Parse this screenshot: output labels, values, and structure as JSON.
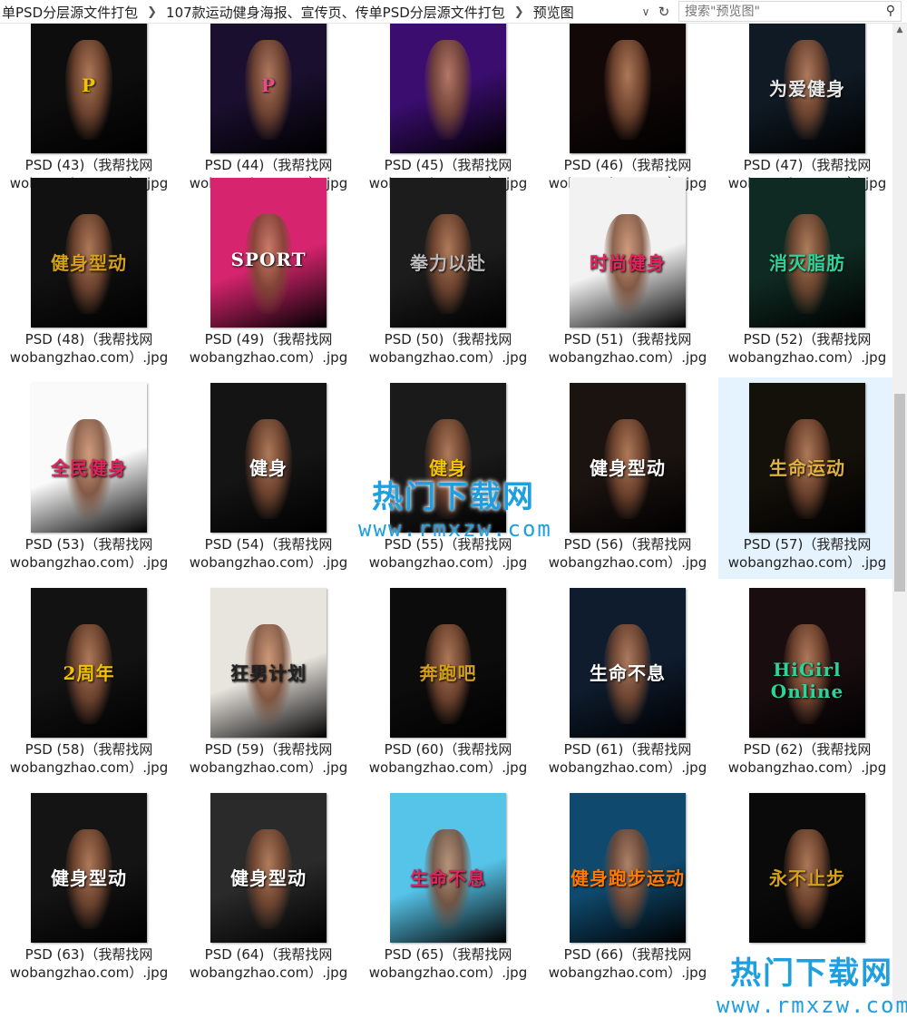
{
  "address_bar": {
    "crumbs": [
      "单PSD分层源文件打包",
      "107款运动健身海报、宣传页、传单PSD分层源文件打包",
      "预览图"
    ],
    "dropdown_icon": "chevron-down-icon",
    "refresh_icon": "refresh-icon"
  },
  "search": {
    "placeholder": "搜索\"预览图\"",
    "icon": "search-icon"
  },
  "files": [
    {
      "line1": "PSD (43)（我帮找网",
      "line2": "wobangzhao.com）.jpg",
      "poster_text": "P",
      "bg": "#0d0d0d",
      "accent": "#f2c300"
    },
    {
      "line1": "PSD (44)（我帮找网",
      "line2": "wobangzhao.com）.jpg",
      "poster_text": "P",
      "bg": "#1a0f2e",
      "accent": "#e84d8a"
    },
    {
      "line1": "PSD (45)（我帮找网",
      "line2": "wobangzhao.com）.jpg",
      "poster_text": "",
      "bg": "#3a0d6e",
      "accent": "#a63df0"
    },
    {
      "line1": "PSD (46)（我帮找网",
      "line2": "wobangzhao.com）.jpg",
      "poster_text": "",
      "bg": "#120808",
      "accent": "#c0392b"
    },
    {
      "line1": "PSD (47)（我帮找网",
      "line2": "wobangzhao.com）.jpg",
      "poster_text": "为爱健身",
      "bg": "#0f1a24",
      "accent": "#e8e8e8"
    },
    {
      "line1": "PSD (48)（我帮找网",
      "line2": "wobangzhao.com）.jpg",
      "poster_text": "健身型动",
      "bg": "#111111",
      "accent": "#d4a017"
    },
    {
      "line1": "PSD (49)（我帮找网",
      "line2": "wobangzhao.com）.jpg",
      "poster_text": "SPORT",
      "bg": "#d6246e",
      "accent": "#ffffff"
    },
    {
      "line1": "PSD (50)（我帮找网",
      "line2": "wobangzhao.com）.jpg",
      "poster_text": "拳力以赴",
      "bg": "#1c1c1c",
      "accent": "#bbbbbb"
    },
    {
      "line1": "PSD (51)（我帮找网",
      "line2": "wobangzhao.com）.jpg",
      "poster_text": "时尚健身",
      "bg": "#f2f2f2",
      "accent": "#e0245e"
    },
    {
      "line1": "PSD (52)（我帮找网",
      "line2": "wobangzhao.com）.jpg",
      "poster_text": "消灭脂肪",
      "bg": "#0f2a22",
      "accent": "#2bd49a"
    },
    {
      "line1": "PSD (53)（我帮找网",
      "line2": "wobangzhao.com）.jpg",
      "poster_text": "全民健身",
      "bg": "#fafafa",
      "accent": "#e0245e"
    },
    {
      "line1": "PSD (54)（我帮找网",
      "line2": "wobangzhao.com）.jpg",
      "poster_text": "健身",
      "bg": "#141414",
      "accent": "#ffffff"
    },
    {
      "line1": "PSD (55)（我帮找网",
      "line2": "wobangzhao.com）.jpg",
      "poster_text": "健身",
      "bg": "#1a1a1a",
      "accent": "#f2c300"
    },
    {
      "line1": "PSD (56)（我帮找网",
      "line2": "wobangzhao.com）.jpg",
      "poster_text": "健身型动",
      "bg": "#1b1310",
      "accent": "#ffffff"
    },
    {
      "line1": "PSD (57)（我帮找网",
      "line2": "wobangzhao.com）.jpg",
      "poster_text": "生命运动",
      "bg": "#14100a",
      "accent": "#e0b040"
    },
    {
      "line1": "PSD (58)（我帮找网",
      "line2": "wobangzhao.com）.jpg",
      "poster_text": "2周年",
      "bg": "#121212",
      "accent": "#f2c300"
    },
    {
      "line1": "PSD (59)（我帮找网",
      "line2": "wobangzhao.com）.jpg",
      "poster_text": "狂男计划",
      "bg": "#e8e4de",
      "accent": "#222222"
    },
    {
      "line1": "PSD (60)（我帮找网",
      "line2": "wobangzhao.com）.jpg",
      "poster_text": "奔跑吧",
      "bg": "#0c0c0c",
      "accent": "#d4a017"
    },
    {
      "line1": "PSD (61)（我帮找网",
      "line2": "wobangzhao.com）.jpg",
      "poster_text": "生命不息",
      "bg": "#0e1c2e",
      "accent": "#ffffff"
    },
    {
      "line1": "PSD (62)（我帮找网",
      "line2": "wobangzhao.com）.jpg",
      "poster_text": "HiGirl Online",
      "bg": "#1a0d10",
      "accent": "#2bd49a"
    },
    {
      "line1": "PSD (63)（我帮找网",
      "line2": "wobangzhao.com）.jpg",
      "poster_text": "健身型动",
      "bg": "#141414",
      "accent": "#ffffff"
    },
    {
      "line1": "PSD (64)（我帮找网",
      "line2": "wobangzhao.com）.jpg",
      "poster_text": "健身型动",
      "bg": "#2a2a2a",
      "accent": "#ffffff"
    },
    {
      "line1": "PSD (65)（我帮找网",
      "line2": "wobangzhao.com）.jpg",
      "poster_text": "生命不息",
      "bg": "#56c3e8",
      "accent": "#e0245e"
    },
    {
      "line1": "PSD (66)（我帮找网",
      "line2": "wobangzhao.com）.jpg",
      "poster_text": "健身跑步运动",
      "bg": "#0f4a6e",
      "accent": "#ff7a00"
    },
    {
      "line1": "",
      "line2": "",
      "poster_text": "永不止步",
      "bg": "#0a0a0a",
      "accent": "#d4a017"
    }
  ],
  "watermarks": [
    {
      "big": "热门下载网",
      "url": "www.rmxzw.com"
    },
    {
      "big": "热门下载网",
      "url": "www.rmxzw.com"
    }
  ],
  "colors": {
    "selection": "#e5f3ff",
    "watermark": "#1f9fe0"
  }
}
